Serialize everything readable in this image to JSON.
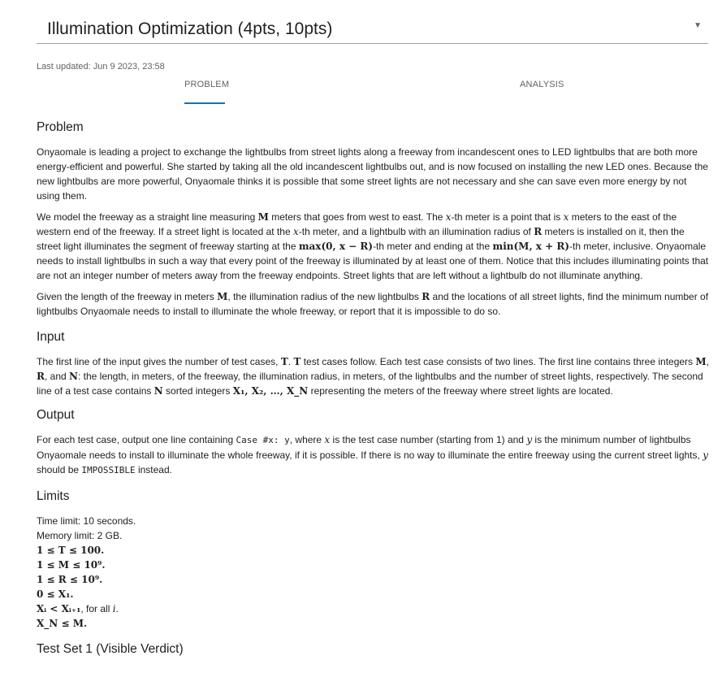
{
  "header": {
    "title": "Illumination Optimization (4pts, 10pts)",
    "dropdown_icon": "caret-down-icon",
    "last_updated": "Last updated: Jun 9 2023, 23:58"
  },
  "tabs": [
    {
      "label": "PROBLEM",
      "active": true
    },
    {
      "label": "ANALYSIS",
      "active": false
    }
  ],
  "accent_color": "#1a73a8",
  "sections": {
    "problem": {
      "heading": "Problem",
      "p1": "Onyaomale is leading a project to exchange the lightbulbs from street lights along a freeway from incandescent ones to LED lightbulbs that are both more energy-efficient and powerful. She started by taking all the old incandescent lightbulbs out, and is now focused on installing the new LED ones. Because the new lightbulbs are more powerful, Onyaomale thinks it is possible that some street lights are not necessary and she can save even more energy by not using them.",
      "p2_parts": [
        "We model the freeway as a straight line measuring ",
        "M",
        " meters that goes from west to east. The ",
        "x",
        "-th meter is a point that is ",
        "x",
        " meters to the east of the western end of the freeway. If a street light is located at the ",
        "x",
        "-th meter, and a lightbulb with an illumination radius of ",
        "R",
        " meters is installed on it, then the street light illuminates the segment of freeway starting at the ",
        "max(0, x − R)",
        "-th meter and ending at the ",
        "min(M, x + R)",
        "-th meter, inclusive. Onyaomale needs to install lightbulbs in such a way that every point of the freeway is illuminated by at least one of them. Notice that this includes illuminating points that are not an integer number of meters away from the freeway endpoints. Street lights that are left without a lightbulb do not illuminate anything."
      ],
      "p3_parts": [
        "Given the length of the freeway in meters ",
        "M",
        ", the illumination radius of the new lightbulbs ",
        "R",
        " and the locations of all street lights, find the minimum number of lightbulbs Onyaomale needs to install to illuminate the whole freeway, or report that it is impossible to do so."
      ]
    },
    "input": {
      "heading": "Input",
      "parts": [
        "The first line of the input gives the number of test cases, ",
        "T",
        ". ",
        "T",
        " test cases follow. Each test case consists of two lines. The first line contains three integers ",
        "M",
        ", ",
        "R",
        ", and ",
        "N",
        ": the length, in meters, of the freeway, the illumination radius, in meters, of the lightbulbs and the number of street lights, respectively. The second line of a test case contains ",
        "N",
        " sorted integers ",
        "X₁, X₂, …, X_N",
        " representing the meters of the freeway where street lights are located."
      ]
    },
    "output": {
      "heading": "Output",
      "parts": [
        "For each test case, output one line containing ",
        "Case #x: y",
        ", where ",
        "x",
        " is the test case number (starting from 1) and ",
        "y",
        " is the minimum number of lightbulbs Onyaomale needs to install to illuminate the whole freeway, if it is possible. If there is no way to illuminate the entire freeway using the current street lights, ",
        "y",
        " should be ",
        "IMPOSSIBLE",
        " instead."
      ]
    },
    "limits": {
      "heading": "Limits",
      "time": "Time limit: 10 seconds.",
      "memory": "Memory limit: 2 GB.",
      "l1": "1 ≤ T ≤ 100.",
      "l2": "1 ≤ M ≤ 10⁹.",
      "l3": "1 ≤ R ≤ 10⁹.",
      "l4": "0 ≤ X₁.",
      "l5a": "Xᵢ < Xᵢ₊₁",
      "l5b": ", for all ",
      "l5c": "i",
      "l5d": ".",
      "l6": "X_N ≤ M."
    },
    "testset": {
      "heading": "Test Set 1 (Visible Verdict)"
    }
  }
}
